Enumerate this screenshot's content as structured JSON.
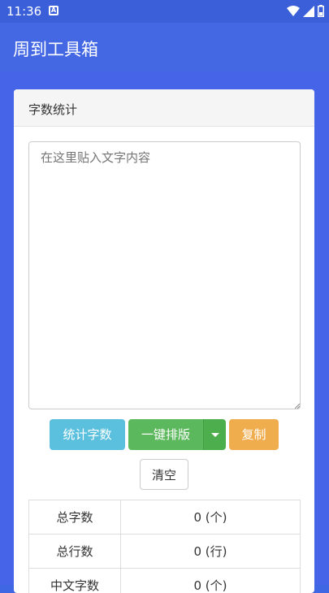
{
  "status_bar": {
    "time": "11:36",
    "a_icon": "A"
  },
  "app_bar": {
    "title": "周到工具箱"
  },
  "card": {
    "title": "字数统计",
    "textarea_placeholder": "在这里贴入文字内容",
    "buttons": {
      "count": "统计字数",
      "format": "一键排版",
      "copy": "复制",
      "clear": "清空"
    },
    "stats": [
      {
        "label": "总字数",
        "value": "0 (个)"
      },
      {
        "label": "总行数",
        "value": "0 (行)"
      },
      {
        "label": "中文字数",
        "value": "0 (个)"
      }
    ]
  },
  "colors": {
    "primary": "#4468e3",
    "info": "#5bc0de",
    "success": "#5cb85c",
    "warning": "#f0ad4e"
  },
  "icons": [
    "wifi-icon",
    "signal-icon",
    "battery-icon",
    "caret-down-icon"
  ]
}
